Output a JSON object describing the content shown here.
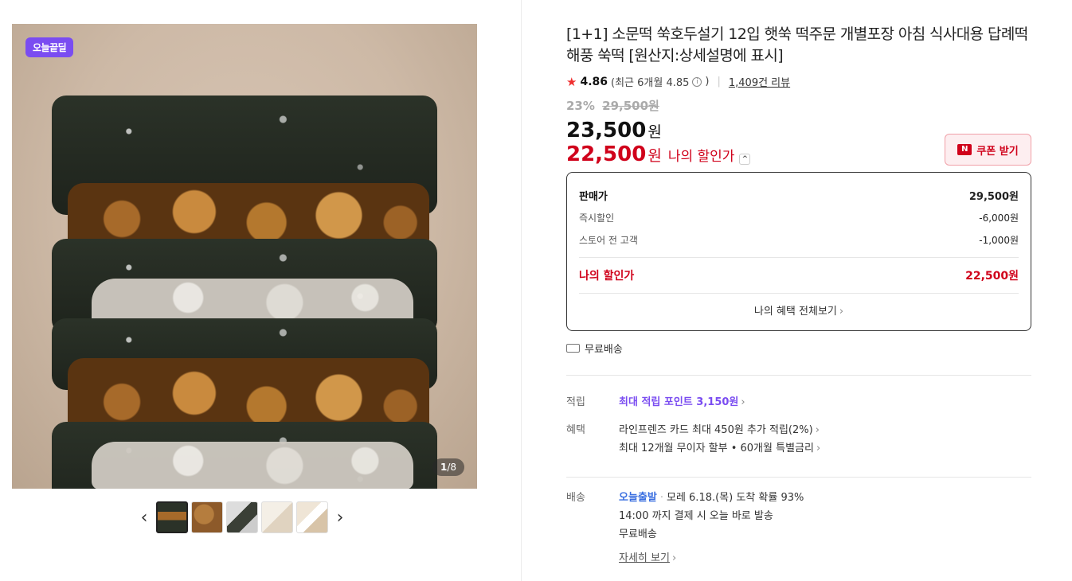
{
  "gallery": {
    "badge": "오늘끝딜",
    "counter_current": "1",
    "counter_total": "/8",
    "prev_icon": "‹",
    "next_icon": "›"
  },
  "product": {
    "title": "[1+1] 소문떡 쑥호두설기 12입 햇쑥 떡주문 개별포장 아침 식사대용 답례떡 해풍 쑥떡 [원산지:상세설명에 표시]",
    "rating": "4.86",
    "rating_recent": "(최근 6개월 4.85",
    "rating_close": ")",
    "review_count": "1,409건 리뷰",
    "discount_rate": "23%",
    "original_price": "29,500원",
    "price": "23,500",
    "price_unit": "원",
    "my_price": "22,500",
    "my_price_unit": "원",
    "my_price_label": "나의 할인가",
    "coupon_button": "쿠폰 받기"
  },
  "breakdown": {
    "rows": [
      {
        "label": "판매가",
        "value": "29,500원"
      },
      {
        "label": "즉시할인",
        "value": "-6,000원"
      },
      {
        "label": "스토어 전 고객",
        "value": "-1,000원"
      }
    ],
    "my_label": "나의 할인가",
    "my_value": "22,500원",
    "all_benefits": "나의 혜택 전체보기"
  },
  "shipping_free": "무료배송",
  "points": {
    "label": "적립",
    "text": "최대 적립 포인트 3,150원"
  },
  "benefits": {
    "label": "혜택",
    "line1": "라인프렌즈 카드 최대 450원 추가 적립(2%)",
    "line2": "최대 12개월 무이자 할부 • 60개월 특별금리"
  },
  "delivery": {
    "label": "배송",
    "service": "오늘출발",
    "arrival": "모레 6.18.(목) 도착 확률 93%",
    "cutoff": "14:00 까지 결제 시 오늘 바로 발송",
    "fee": "무료배송",
    "details": "자세히 보기"
  }
}
